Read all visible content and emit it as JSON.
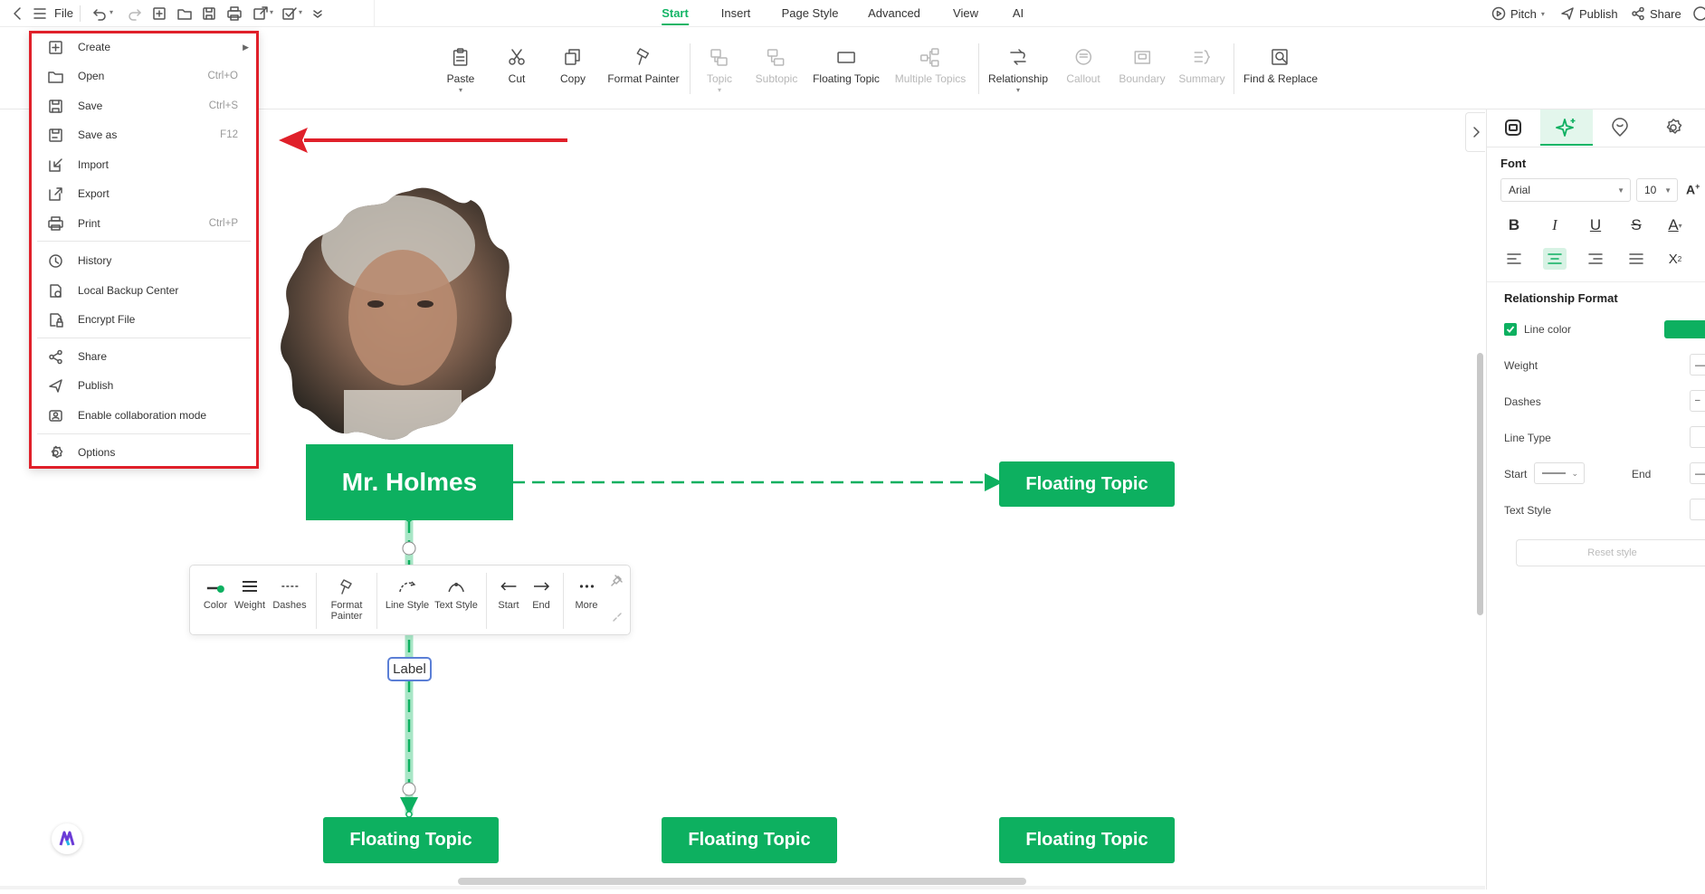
{
  "topbar": {
    "file_label": "File",
    "tabs": [
      {
        "label": "Start",
        "active": true
      },
      {
        "label": "Insert",
        "active": false
      },
      {
        "label": "Page Style",
        "active": false
      },
      {
        "label": "Advanced",
        "active": false
      },
      {
        "label": "View",
        "active": false
      },
      {
        "label": "AI",
        "active": false
      }
    ],
    "right": {
      "pitch": "Pitch",
      "publish": "Publish",
      "share": "Share"
    }
  },
  "ribbon": {
    "buttons": [
      {
        "label": "Paste",
        "icon": "paste-icon",
        "enabled": true
      },
      {
        "label": "Cut",
        "icon": "scissors-icon",
        "enabled": true
      },
      {
        "label": "Copy",
        "icon": "copy-icon",
        "enabled": true
      },
      {
        "label": "Format Painter",
        "icon": "brush-icon",
        "enabled": true
      },
      {
        "label": "Topic",
        "icon": "topic-icon",
        "enabled": false
      },
      {
        "label": "Subtopic",
        "icon": "subtopic-icon",
        "enabled": false
      },
      {
        "label": "Floating Topic",
        "icon": "floating-topic-icon",
        "enabled": true
      },
      {
        "label": "Multiple Topics",
        "icon": "multiple-topics-icon",
        "enabled": false
      },
      {
        "label": "Relationship",
        "icon": "relationship-icon",
        "enabled": true
      },
      {
        "label": "Callout",
        "icon": "callout-icon",
        "enabled": false
      },
      {
        "label": "Boundary",
        "icon": "boundary-icon",
        "enabled": false
      },
      {
        "label": "Summary",
        "icon": "summary-icon",
        "enabled": false
      },
      {
        "label": "Find & Replace",
        "icon": "find-replace-icon",
        "enabled": true
      }
    ]
  },
  "file_menu": {
    "items": [
      {
        "label": "Create",
        "shortcut": "",
        "icon": "plus-square-icon",
        "submenu": true
      },
      {
        "label": "Open",
        "shortcut": "Ctrl+O",
        "icon": "folder-open-icon"
      },
      {
        "label": "Save",
        "shortcut": "Ctrl+S",
        "icon": "save-icon"
      },
      {
        "label": "Save as",
        "shortcut": "F12",
        "icon": "save-as-icon"
      },
      {
        "label": "Import",
        "shortcut": "",
        "icon": "import-icon"
      },
      {
        "label": "Export",
        "shortcut": "",
        "icon": "export-icon"
      },
      {
        "label": "Print",
        "shortcut": "Ctrl+P",
        "icon": "print-icon"
      },
      {
        "label": "History",
        "shortcut": "",
        "icon": "history-icon"
      },
      {
        "label": "Local Backup Center",
        "shortcut": "",
        "icon": "backup-icon"
      },
      {
        "label": "Encrypt File",
        "shortcut": "",
        "icon": "lock-file-icon"
      },
      {
        "label": "Share",
        "shortcut": "",
        "icon": "share-icon"
      },
      {
        "label": "Publish",
        "shortcut": "",
        "icon": "send-icon"
      },
      {
        "label": "Enable collaboration mode",
        "shortcut": "",
        "icon": "collaboration-icon"
      },
      {
        "label": "Options",
        "shortcut": "",
        "icon": "settings-icon"
      }
    ]
  },
  "canvas": {
    "main_topic": "Mr. Holmes",
    "floating_topic": "Floating Topic",
    "relationship_label": "Label"
  },
  "mini_toolbar": {
    "items": [
      {
        "label": "Color"
      },
      {
        "label": "Weight"
      },
      {
        "label": "Dashes"
      },
      {
        "label": "Format Painter"
      },
      {
        "label": "Line Style"
      },
      {
        "label": "Text Style"
      },
      {
        "label": "Start"
      },
      {
        "label": "End"
      },
      {
        "label": "More"
      }
    ]
  },
  "right_panel": {
    "font_heading": "Font",
    "font_family": "Arial",
    "font_size": "10",
    "rel_heading": "Relationship Format",
    "line_color_label": "Line color",
    "line_color_checked": true,
    "line_color": "#0db060",
    "weight_label": "Weight",
    "dashes_label": "Dashes",
    "line_type_label": "Line Type",
    "start_label": "Start",
    "end_label": "End",
    "text_style_label": "Text Style",
    "reset_label": "Reset style"
  },
  "colors": {
    "accent": "#0db060",
    "highlight_border": "#e0202a"
  }
}
